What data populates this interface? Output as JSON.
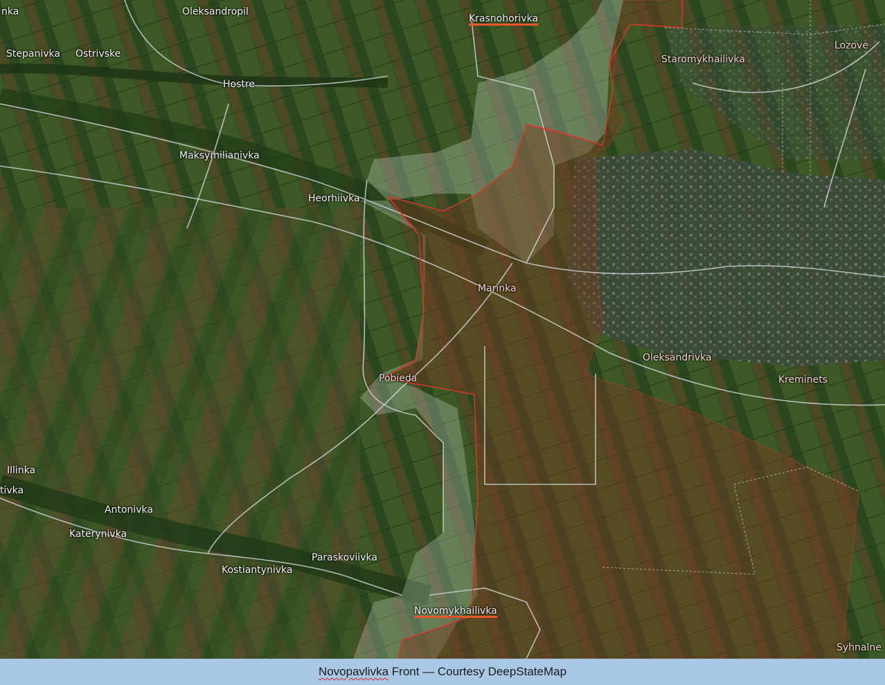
{
  "map": {
    "colors": {
      "occupied_fill": "#8a3a22",
      "occupied_border": "#e0372a",
      "grey_zone_fill": "#c8d8c8",
      "road": "#d9dde0",
      "fields_dark": "#2f4a22",
      "fields_brown": "#5b4a2a"
    },
    "labels": {
      "nka": "nka",
      "oleksandropil": "Oleksandropil",
      "krasnohorivka": "Krasnohorivka",
      "stepanivka": "Stepanivka",
      "ostrivske": "Ostrivske",
      "hostre": "Hostre",
      "staromykhailivka": "Staromykhailivka",
      "lozove": "Lozove",
      "maksymilianivka": "Maksymilianivka",
      "heorhiivka": "Heorhiivka",
      "marinka": "Marinka",
      "oleksandrivka": "Oleksandrivka",
      "kreminets": "Kreminets",
      "pobieda": "Pobieda",
      "illinka": "Illinka",
      "tivka": "tivka",
      "antonivka": "Antonivka",
      "katerynivka": "Katerynivka",
      "paraskoviivka": "Paraskoviivka",
      "kostiantynivka": "Kostiantynivka",
      "novomykhailivka": "Novomykhailivka",
      "synhalne": "Syhnalne"
    }
  },
  "caption": {
    "word_underlined": "Novopavlivka",
    "rest": " Front — Courtesy DeepStateMap"
  }
}
